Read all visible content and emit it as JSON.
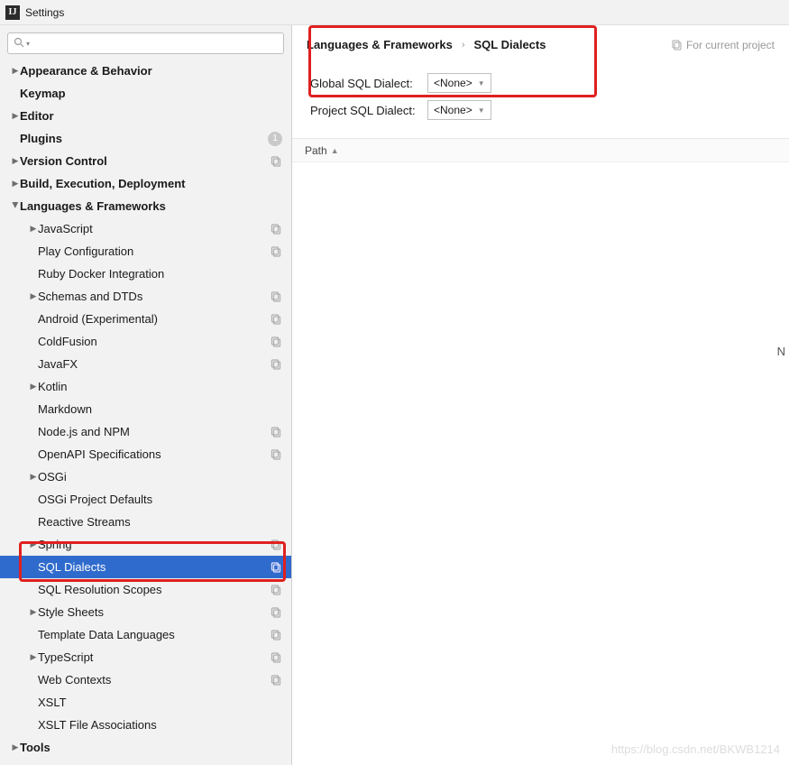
{
  "window": {
    "title": "Settings"
  },
  "sidebar": {
    "items": [
      {
        "label": "Appearance & Behavior",
        "level": 0,
        "bold": true,
        "arrow": "right"
      },
      {
        "label": "Keymap",
        "level": 0,
        "bold": true
      },
      {
        "label": "Editor",
        "level": 0,
        "bold": true,
        "arrow": "right"
      },
      {
        "label": "Plugins",
        "level": 0,
        "bold": true,
        "badge": "1"
      },
      {
        "label": "Version Control",
        "level": 0,
        "bold": true,
        "arrow": "right",
        "copy": true
      },
      {
        "label": "Build, Execution, Deployment",
        "level": 0,
        "bold": true,
        "arrow": "right"
      },
      {
        "label": "Languages & Frameworks",
        "level": 0,
        "bold": true,
        "arrow": "down"
      },
      {
        "label": "JavaScript",
        "level": 1,
        "arrow": "right",
        "copy": true
      },
      {
        "label": "Play Configuration",
        "level": 1,
        "copy": true
      },
      {
        "label": "Ruby Docker Integration",
        "level": 1
      },
      {
        "label": "Schemas and DTDs",
        "level": 1,
        "arrow": "right",
        "copy": true
      },
      {
        "label": "Android (Experimental)",
        "level": 1,
        "copy": true
      },
      {
        "label": "ColdFusion",
        "level": 1,
        "copy": true
      },
      {
        "label": "JavaFX",
        "level": 1,
        "copy": true
      },
      {
        "label": "Kotlin",
        "level": 1,
        "arrow": "right"
      },
      {
        "label": "Markdown",
        "level": 1
      },
      {
        "label": "Node.js and NPM",
        "level": 1,
        "copy": true
      },
      {
        "label": "OpenAPI Specifications",
        "level": 1,
        "copy": true
      },
      {
        "label": "OSGi",
        "level": 1,
        "arrow": "right"
      },
      {
        "label": "OSGi Project Defaults",
        "level": 1
      },
      {
        "label": "Reactive Streams",
        "level": 1
      },
      {
        "label": "Spring",
        "level": 1,
        "arrow": "right",
        "copy": true
      },
      {
        "label": "SQL Dialects",
        "level": 1,
        "copy": true,
        "selected": true
      },
      {
        "label": "SQL Resolution Scopes",
        "level": 1,
        "copy": true
      },
      {
        "label": "Style Sheets",
        "level": 1,
        "arrow": "right",
        "copy": true
      },
      {
        "label": "Template Data Languages",
        "level": 1,
        "copy": true
      },
      {
        "label": "TypeScript",
        "level": 1,
        "arrow": "right",
        "copy": true
      },
      {
        "label": "Web Contexts",
        "level": 1,
        "copy": true
      },
      {
        "label": "XSLT",
        "level": 1
      },
      {
        "label": "XSLT File Associations",
        "level": 1
      },
      {
        "label": "Tools",
        "level": 0,
        "bold": true,
        "arrow": "right"
      }
    ]
  },
  "breadcrumb": {
    "parent": "Languages & Frameworks",
    "current": "SQL Dialects",
    "scope": "For current project"
  },
  "dialects": {
    "global_label": "Global SQL Dialect:",
    "global_value": "<None>",
    "project_label": "Project SQL Dialect:",
    "project_value": "<None>"
  },
  "table": {
    "path_header": "Path"
  },
  "watermark": "https://blog.csdn.net/BKWB1214",
  "right_edge_letter": "N"
}
